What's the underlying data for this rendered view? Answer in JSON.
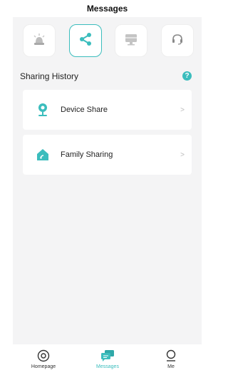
{
  "header": {
    "title": "Messages"
  },
  "categories": [
    {
      "icon": "alarm-siren-icon",
      "active": false
    },
    {
      "icon": "share-icon",
      "active": true
    },
    {
      "icon": "monitor-icon",
      "active": false
    },
    {
      "icon": "headset-icon",
      "active": false
    }
  ],
  "section": {
    "title": "Sharing History",
    "help_symbol": "?"
  },
  "cards": [
    {
      "label": "Device Share",
      "icon": "camera-icon",
      "chevron": ">"
    },
    {
      "label": "Family Sharing",
      "icon": "home-icon",
      "chevron": ">"
    }
  ],
  "tabbar": [
    {
      "label": "Homepage",
      "icon": "camera-lens-icon",
      "active": false
    },
    {
      "label": "Messages",
      "icon": "messages-icon",
      "active": true
    },
    {
      "label": "Me",
      "icon": "person-icon",
      "active": false
    }
  ],
  "colors": {
    "accent": "#3bbdbd",
    "page_bg": "#f4f4f5",
    "card_bg": "#ffffff"
  }
}
